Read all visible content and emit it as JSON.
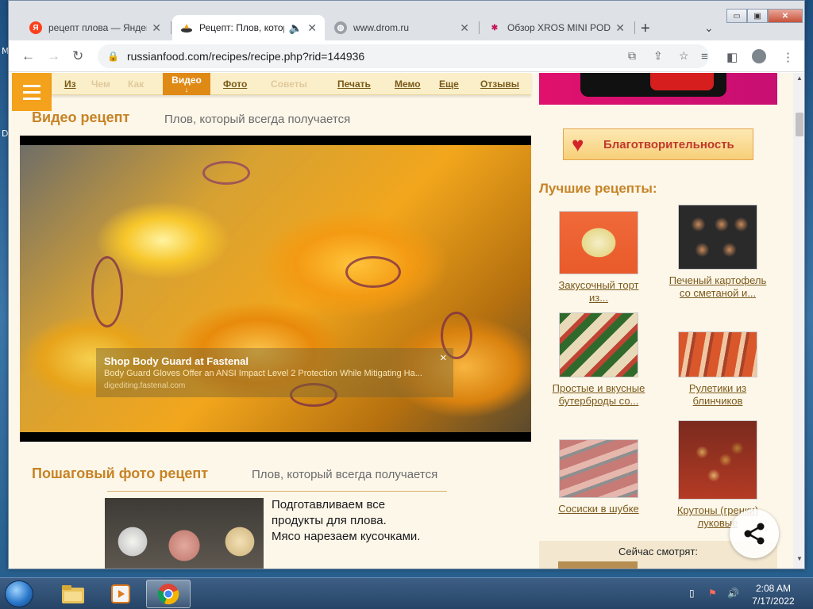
{
  "desktop": {
    "left_chars": [
      "M",
      "D"
    ]
  },
  "browser": {
    "tabs": [
      {
        "title": "рецепт плова — Яндекс",
        "icon": "yandex-icon",
        "favicon_letter": "Я"
      },
      {
        "title": "Рецепт: Плов, который всегда получается",
        "icon": "russianfood-icon",
        "active": true
      },
      {
        "title": "www.drom.ru",
        "icon": "globe-icon"
      },
      {
        "title": "Обзор XROS MINI POD",
        "icon": "vape-site-icon"
      }
    ],
    "new_tab": "+",
    "tab_menu": "⌄",
    "window_buttons": {
      "minimize": "▭",
      "maximize": "▣",
      "close": "✕"
    },
    "address": "russianfood.com/recipes/recipe.php?rid=144936",
    "nav": {
      "back": "←",
      "forward": "→",
      "reload": "↻"
    }
  },
  "site": {
    "menu": [
      {
        "label": "Из",
        "state": "normal"
      },
      {
        "label": "Чем",
        "state": "faded"
      },
      {
        "label": "Как",
        "state": "faded"
      },
      {
        "label": "Видео",
        "state": "active"
      },
      {
        "label": "Фото",
        "state": "normal"
      },
      {
        "label": "Советы",
        "state": "faded"
      },
      {
        "label": "Печать",
        "state": "normal"
      },
      {
        "label": "Мемо",
        "state": "normal"
      },
      {
        "label": "Еще",
        "state": "normal"
      },
      {
        "label": "Отзывы",
        "state": "normal"
      }
    ],
    "video_section": {
      "title": "Видео рецепт",
      "subtitle": "Плов, который всегда получается"
    },
    "ad": {
      "headline": "Shop Body Guard at Fastenal",
      "body": "Body Guard Gloves Offer an ANSI Impact Level 2 Protection While Mitigating Ha...",
      "source": "digediting.fastenal.com",
      "close": "✕"
    },
    "photo_section": {
      "title": "Пошаговый фото рецепт",
      "subtitle": "Плов, который всегда получается",
      "step_text": [
        "Подготавливаем все",
        "продукты для плова.",
        "Мясо нарезаем кусочками."
      ]
    },
    "charity": "Благотворительность",
    "best_title": "Лучшие рецепты:",
    "best_recipes": [
      {
        "label1": "Закусочный торт",
        "label2": "из..."
      },
      {
        "label1": "Печеный картофель",
        "label2": "со сметаной и..."
      },
      {
        "label1": "Простые и вкусные",
        "label2": "бутерброды со..."
      },
      {
        "label1": "Рулетики из",
        "label2": "блинчиков"
      },
      {
        "label1": "Сосиски в шубке",
        "label2": ""
      },
      {
        "label1": "Крутоны (гренки)",
        "label2": "луковые"
      }
    ],
    "now_watching": "Сейчас смотрят:"
  },
  "taskbar": {
    "time": "2:08 AM",
    "date": "7/17/2022"
  },
  "colors": {
    "accent": "#f4a11c",
    "title": "#c78325",
    "link": "#7a5a1a"
  }
}
